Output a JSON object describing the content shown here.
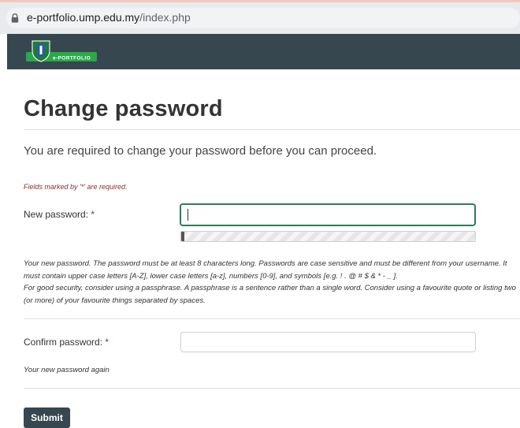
{
  "browser": {
    "url_domain": "e-portfolio.ump.edu.my",
    "url_path": "/index.php",
    "icon": "lock-icon"
  },
  "header": {
    "logo_text": "e-PORTFOLIO",
    "logo_icon": "shield-logo"
  },
  "page": {
    "title": "Change password",
    "intro": "You are required to change your password before you can proceed.",
    "required_note": "Fields marked by '*' are required."
  },
  "form": {
    "new_password": {
      "label": "New password:",
      "required_mark": "*",
      "value": "",
      "strength_fraction": 0.01
    },
    "new_password_help": [
      "Your new password. The password must be at least 8 characters long. Passwords are case sensitive and must be different from your username. It must contain upper case letters [A-Z], lower case letters [a-z], numbers [0-9], and symbols [e.g. ! . @ # $ & * - _ ].",
      "For good security, consider using a passphrase. A passphrase is a sentence rather than a single word. Consider using a favourite quote or listing two (or more) of your favourite things separated by spaces."
    ],
    "confirm_password": {
      "label": "Confirm password:",
      "required_mark": "*",
      "value": "",
      "help": "Your new password again"
    },
    "submit_label": "Submit"
  },
  "colors": {
    "header_bg": "#37474f",
    "focus_border": "#2e7d55",
    "required_red": "#8b2e2e"
  }
}
